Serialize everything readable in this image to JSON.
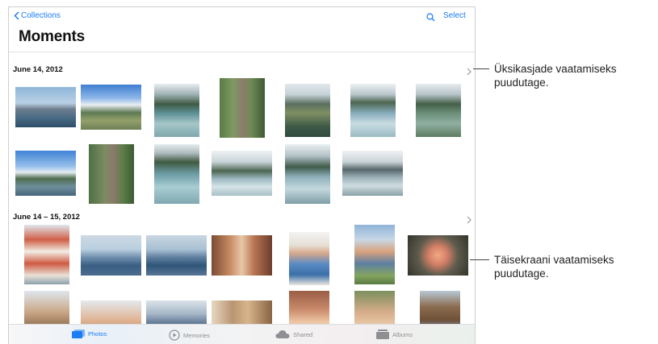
{
  "nav": {
    "back_label": "Collections",
    "select_label": "Select",
    "title": "Moments"
  },
  "sections": [
    {
      "label": "June 14, 2012"
    },
    {
      "label": "June 14 – 15, 2012"
    }
  ],
  "tabs": [
    {
      "label": "Photos",
      "active": true
    },
    {
      "label": "Memories"
    },
    {
      "label": "Shared"
    },
    {
      "label": "Albums"
    }
  ],
  "callouts": {
    "top": [
      "Üksikasjade vaatamiseks",
      "puudutage."
    ],
    "bottom": [
      "Täisekraani vaatamiseks",
      "puudutage."
    ]
  },
  "colors": {
    "accent": "#1b7cf5",
    "inactive_tab": "#8e8e93"
  }
}
